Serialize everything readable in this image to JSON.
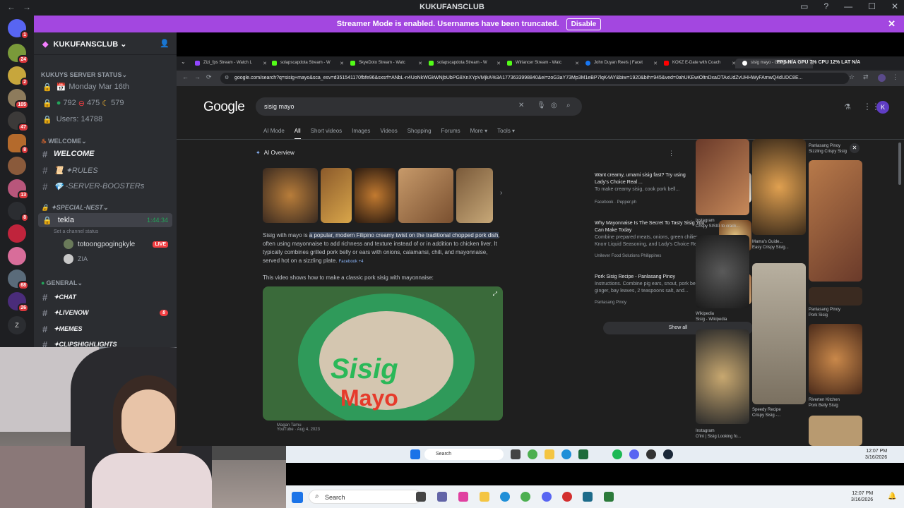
{
  "window": {
    "title": "KUKUFANSCLUB"
  },
  "banner": {
    "text": "Streamer Mode is enabled. Usernames have been truncated.",
    "button": "Disable"
  },
  "servers": [
    {
      "badge": "1"
    },
    {
      "badge": "24"
    },
    {
      "badge": "2"
    },
    {
      "badge": "105"
    },
    {
      "badge": "47"
    },
    {
      "badge": "8"
    },
    {
      "badge": ""
    },
    {
      "badge": "13"
    },
    {
      "badge": "8"
    },
    {
      "badge": ""
    },
    {
      "badge": ""
    },
    {
      "badge": "68"
    },
    {
      "badge": "26"
    },
    {
      "badge": "Z"
    }
  ],
  "sidebar": {
    "server_name": "KUKUFANSCLUB",
    "stats_category": "KUKUYS SERVER STATUS",
    "date": "Monday Mar 16th",
    "online": "792",
    "idle": "475",
    "dnd": "579",
    "users": "Users: 14788",
    "welcome_category": "WELCOME",
    "ch_welcome": "WELCOME",
    "ch_rules": "✦RULES",
    "ch_boosters": "-SERVER-BOOSTERs",
    "special_category": "✦Special-Nest",
    "voice_channel": "tekla",
    "voice_timer": "1:44:34",
    "voice_status": "Set a channel status",
    "voice_user1": "totoongpogingkyle",
    "live": "LIVE",
    "voice_user2": "ZIA",
    "general_category": "GENERAL",
    "ch_chat": "✦CHAT",
    "ch_livenow": "✦LIVENOW",
    "ch_livenow_badge": "8",
    "ch_memes": "✦MEMES",
    "ch_clips": "✦CLIPSHIGHLIGHTS"
  },
  "browser": {
    "tabs": [
      "Zizi_fps Stream - Watch L",
      "solapscapdota Stream - W",
      "SkyeDoto Stream - Watc",
      "solapscapdota Stream - W",
      "Wiriancer Stream - Watc",
      "John Duyan Reels | Facet",
      "KOKZ E-Date with Coach",
      "sisig mayo - Google S"
    ],
    "url": "google.com/search?q=sisig+mayo&sca_esv=d351541170fbfe96&sxsrf=ANbL-n4UoNkWGkWNjbUbPG8XnXYpVMjkA%3A1773633998840&ei=zoG3aY73Mp3M1eBP7lqK4AY&biw=1920&bih=945&ved=0ahUKEwiOltnDxaOTAxUdZvUHHWyFAmwQ4dUDC8E...",
    "overlay_stats": "FPS N/A   GPU 7%   CPU 12%   LAT N/A"
  },
  "google": {
    "logo": "Google",
    "query": "sisig mayo",
    "tabs": [
      "AI Mode",
      "All",
      "Short videos",
      "Images",
      "Videos",
      "Shopping",
      "Forums",
      "More",
      "Tools"
    ],
    "ai_label": "AI Overview",
    "ai_text_pre": "Sisig with mayo is ",
    "ai_text_hl": "a popular, modern Filipino creamy twist on the traditional chopped pork dish",
    "ai_text_post": ", often using mayonnaise to add richness and texture instead of or in addition to chicken liver. It typically combines grilled pork belly or ears with onions, calamansi, chili, and mayonnaise, served hot on a sizzling plate.",
    "ai_source": "Facebook +4",
    "video_intro": "This video shows how to make a classic pork sisig with mayonnaise:",
    "video_title1": "Sisig",
    "video_title2": "Mayo",
    "video_channel": "Magan Tamu",
    "video_meta": "YouTube · Aug 4, 2023",
    "cards": [
      {
        "title": "Want creamy, umami sisig fast? Try using Lady's Choice Real ...",
        "desc": "To make creamy sisig, cook pork bell...",
        "source": "Facebook · Pepper.ph"
      },
      {
        "title": "Why Mayonnaise Is The Secret To Tasty Sisig You Can Make Today",
        "desc": "Combine prepared meats, onions, green chilies, Knorr Liquid Seasoning, and Lady's Choice Re...",
        "source": "Unilever Food Solutions Philippines"
      },
      {
        "title": "Pork Sisig Recipe - Panlasang Pinoy",
        "desc": "Instructions. Combine pig ears, snout, pork belly, ginger, bay leaves, 2 teaspoons salt, and...",
        "source": "Panlasang Pinoy"
      }
    ],
    "show_all": "Show all",
    "images": [
      {
        "source": "Instagram",
        "caption": "Crispy SISIG to crack..."
      },
      {
        "source": "Mama's Guide...",
        "caption": "Easy Crispy Sisig..."
      },
      {
        "source": "Panlasang Pinoy",
        "caption": "Sizzling Crispy Sisig"
      },
      {
        "source": "Wikipedia",
        "caption": "Sisig - Wikipedia"
      },
      {
        "source": "Panlasang Pinoy",
        "caption": "Pork Sisig"
      },
      {
        "source": "Speedy Recipe",
        "caption": "Crispy Sisig -..."
      },
      {
        "source": "Riverten Kitchen",
        "caption": "Pork Belly Sisig"
      },
      {
        "source": "Instagram",
        "caption": "O'ini | Sisig Looking fo..."
      }
    ]
  },
  "taskbar": {
    "search": "Search",
    "time": "12:07 PM",
    "date": "3/16/2026"
  },
  "colors": {
    "banner": "#a347e0",
    "discord_bg": "#2b2d31",
    "google_bg": "#1f1f1f"
  }
}
